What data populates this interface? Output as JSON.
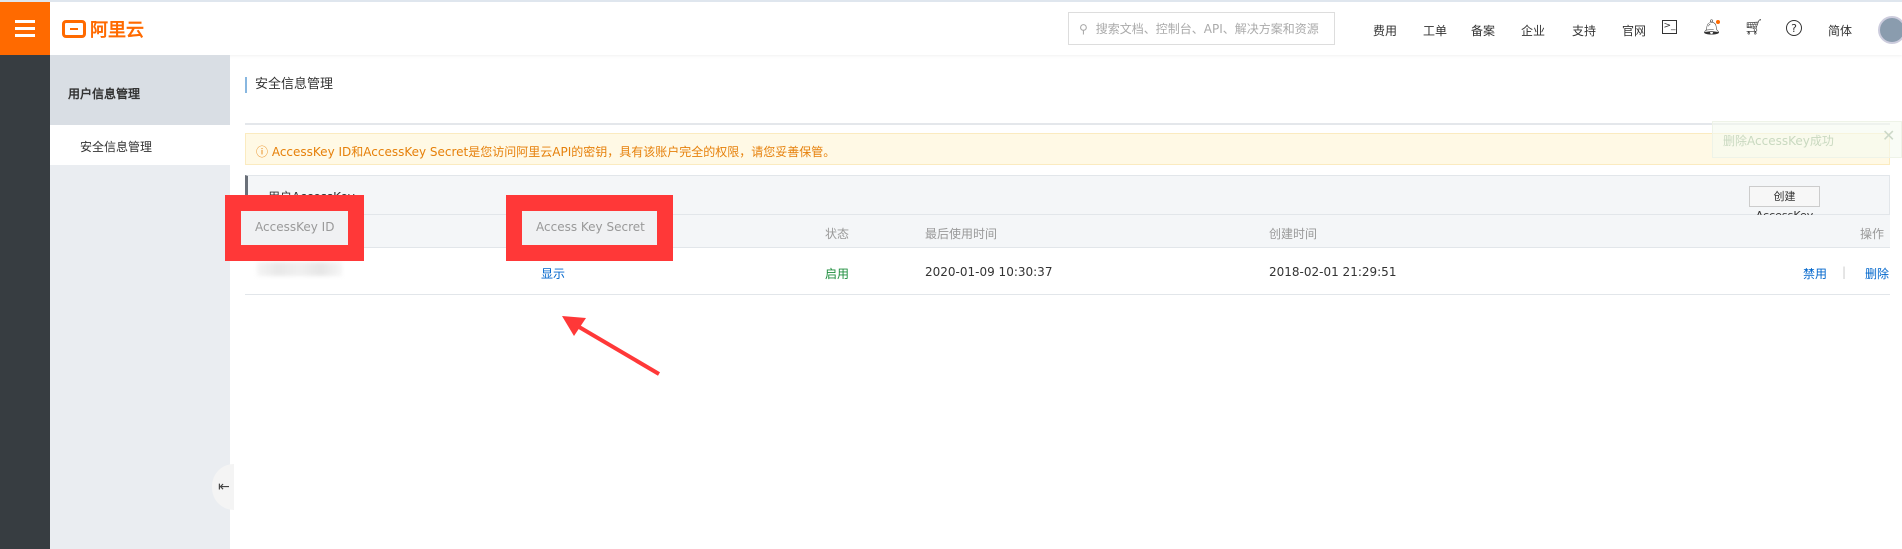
{
  "header": {
    "logo_text": "阿里云",
    "search_placeholder": "搜索文档、控制台、API、解决方案和资源",
    "nav": [
      "费用",
      "工单",
      "备案",
      "企业",
      "支持",
      "官网"
    ],
    "lang": "简体",
    "icons": [
      "terminal-icon",
      "bell-icon",
      "cart-icon",
      "help-icon"
    ]
  },
  "sidebar": {
    "group": "用户信息管理",
    "items": [
      {
        "label": "安全信息管理",
        "active": true
      }
    ]
  },
  "main": {
    "title": "安全信息管理",
    "warning": "AccessKey ID和AccessKey Secret是您访问阿里云API的密钥，具有该账户完全的权限，请您妥善保管。",
    "toast": "删除AccessKey成功",
    "panel_title": "用户AccessKey",
    "create_button": "创建AccessKey",
    "columns": [
      "AccessKey ID",
      "Access Key Secret",
      "状态",
      "最后使用时间",
      "创建时间",
      "操作"
    ],
    "rows": [
      {
        "secret_link": "显示",
        "status": "启用",
        "last_used": "2020-01-09 10:30:37",
        "created": "2018-02-01 21:29:51",
        "actions": [
          "禁用",
          "删除"
        ]
      }
    ]
  },
  "colors": {
    "brand": "#ff6a00",
    "annotation": "#ff3838",
    "link": "#0066cc",
    "status_enabled": "#1e8e3e"
  }
}
